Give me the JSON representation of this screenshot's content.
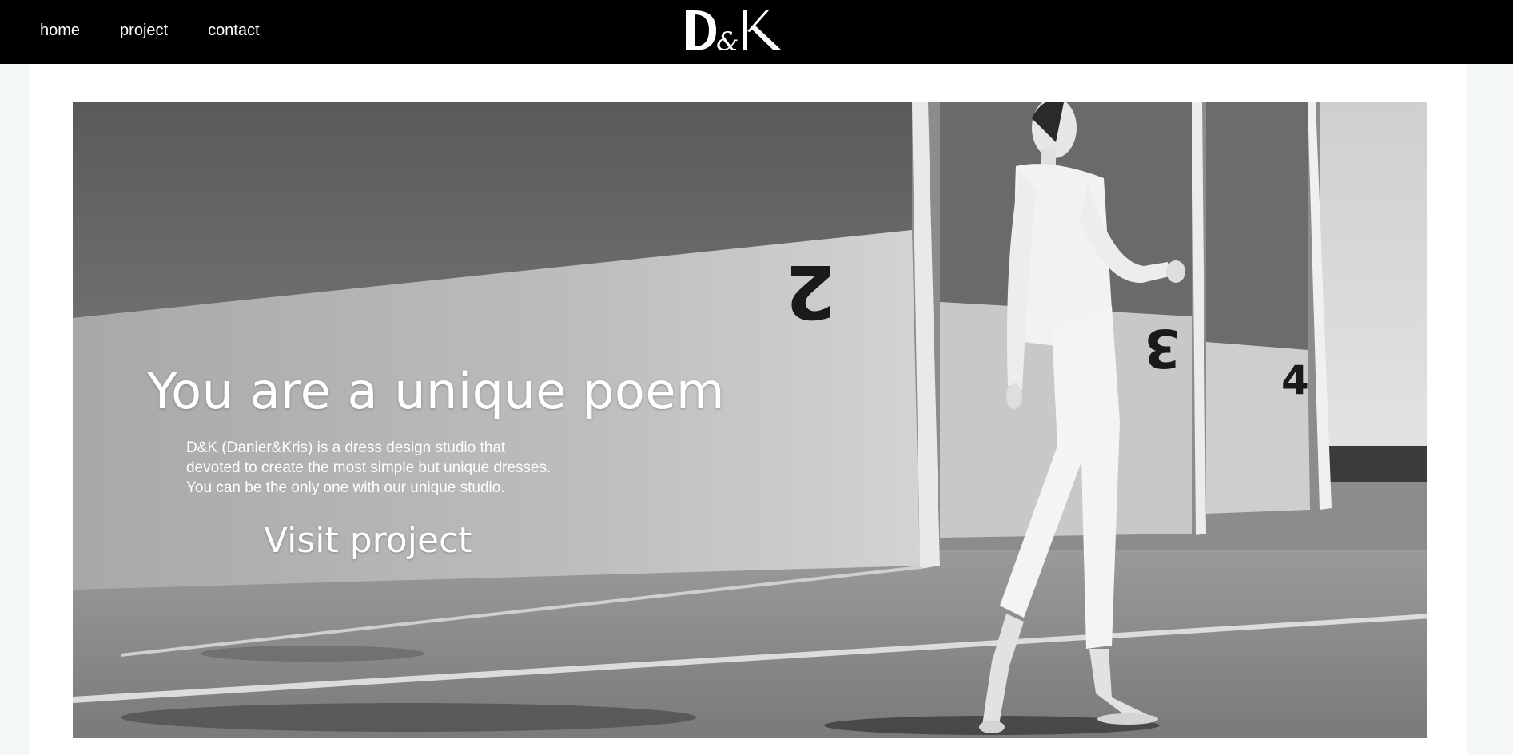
{
  "nav": {
    "items": [
      {
        "label": "home"
      },
      {
        "label": "project"
      },
      {
        "label": "contact"
      }
    ]
  },
  "brand": {
    "logo_text": "D&K"
  },
  "hero": {
    "headline": "You are a unique poem",
    "description_lines": [
      "D&K (Danier&Kris) is a dress design studio that",
      "devoted to create the most simple but unique dresses.",
      "You can be the only one with our unique studio."
    ],
    "cta_label": "Visit project",
    "wall_numbers": [
      "2",
      "3",
      "4"
    ]
  },
  "colors": {
    "topbar": "#000000",
    "page_background": "#f4f7f8",
    "panel": "#ffffff",
    "text_on_dark": "#ffffff"
  }
}
